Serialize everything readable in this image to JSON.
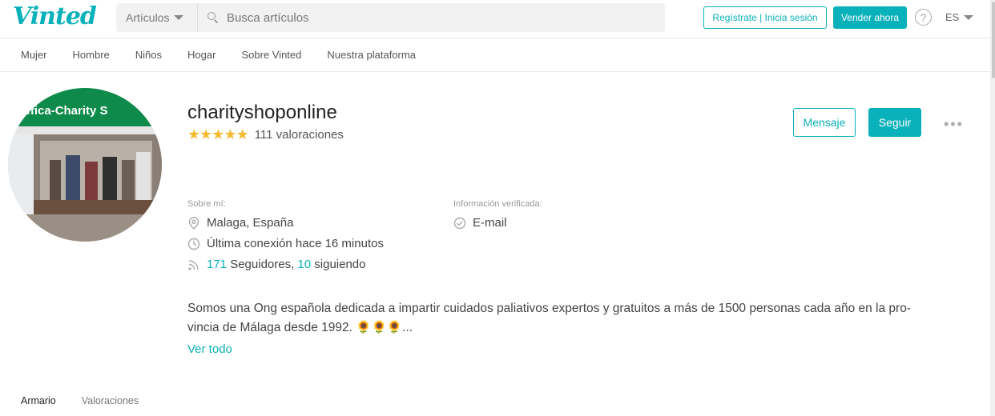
{
  "header": {
    "logo": "Vinted",
    "category_select": "Artículos",
    "search_placeholder": "Busca artículos",
    "register_label": "Regístrate | Inicia sesión",
    "sell_label": "Vender ahora",
    "help_label": "?",
    "language": "ES"
  },
  "nav": {
    "items": [
      {
        "label": "Mujer"
      },
      {
        "label": "Hombre"
      },
      {
        "label": "Niños"
      },
      {
        "label": "Hogar"
      },
      {
        "label": "Sobre Vinted"
      },
      {
        "label": "Nuestra plataforma"
      }
    ]
  },
  "profile": {
    "avatar_banner_text": "enéfica-Charity S",
    "username": "charityshoponline",
    "rating_stars": 5,
    "rating_text": "111 valoraciones",
    "message_label": "Mensaje",
    "follow_label": "Seguir",
    "more_label": "•••",
    "about_label": "Sobre mí:",
    "location": "Malaga, España",
    "last_seen": "Última conexión hace 16 minutos",
    "followers_count": "171",
    "followers_label": " Seguidores, ",
    "following_count": "10",
    "following_label": " siguiendo",
    "verified_label": "Información verificada:",
    "verified_email": "E-mail",
    "bio_line1": "Somos una Ong española dedicada a impartir cuidados paliativos expertos y gratuitos a más de 1500 personas cada año en la pro-",
    "bio_line2": "vincia de Málaga desde 1992. 🌻🌻🌻...",
    "see_all": "Ver todo"
  },
  "tabs": [
    {
      "label": "Armario",
      "active": true
    },
    {
      "label": "Valoraciones",
      "active": false
    }
  ],
  "colors": {
    "brand": "#09b1ba",
    "star": "#f3bb31"
  }
}
